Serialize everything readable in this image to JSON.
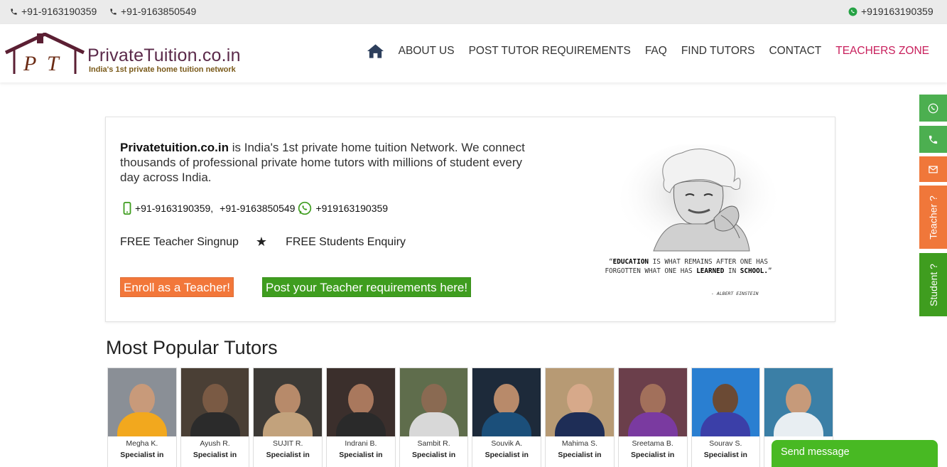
{
  "topbar": {
    "phone1": "+91-9163190359",
    "phone2": "+91-9163850549",
    "whatsapp": "+919163190359"
  },
  "logo": {
    "brand": "PrivateTuition.co.in",
    "tagline": "India's 1st private home tuition network"
  },
  "nav": {
    "items": [
      "ABOUT US",
      "POST TUTOR REQUIREMENTS",
      "FAQ",
      "FIND TUTORS",
      "CONTACT",
      "TEACHERS ZONE"
    ],
    "active_color": "#c81e5b"
  },
  "side_buttons": {
    "teacher": "Teacher ?",
    "student": "Student ?"
  },
  "intro": {
    "brand": "Privatetuition.co.in",
    "text": " is India's 1st private home tuition Network. We connect thousands of professional private home tutors with millions of student every day across India.",
    "phone1": "+91-9163190359,",
    "phone2": "+91-9163850549",
    "whatsapp": "+919163190359",
    "free_teacher": "FREE Teacher Singnup",
    "free_students": "FREE Students Enquiry",
    "enroll_button": "Enroll as a Teacher!",
    "post_button": "Post your Teacher requirements here!"
  },
  "quote": {
    "q1": "EDUCATION",
    "t1": " IS WHAT REMAINS AFTER ONE HAS FORGOTTEN WHAT ONE HAS ",
    "q2": "LEARNED",
    "t2": " IN ",
    "q3": "SCHOOL.",
    "author": "- ALBERT EINSTEIN"
  },
  "popular": {
    "title": "Most Popular Tutors",
    "tutors": [
      {
        "name": "Megha K.",
        "spec": "Specialist in"
      },
      {
        "name": "Ayush R.",
        "spec": "Specialist in"
      },
      {
        "name": "SUJIT R.",
        "spec": "Specialist in"
      },
      {
        "name": "Indrani B.",
        "spec": "Specialist in"
      },
      {
        "name": "Sambit R.",
        "spec": "Specialist in"
      },
      {
        "name": "Souvik A.",
        "spec": "Specialist in"
      },
      {
        "name": "Mahima S.",
        "spec": "Specialist in"
      },
      {
        "name": "Sreetama B.",
        "spec": "Specialist in"
      },
      {
        "name": "Sourav S.",
        "spec": "Specialist in"
      },
      {
        "name": "",
        "spec": ""
      }
    ]
  },
  "chat": {
    "label": "Send message"
  }
}
